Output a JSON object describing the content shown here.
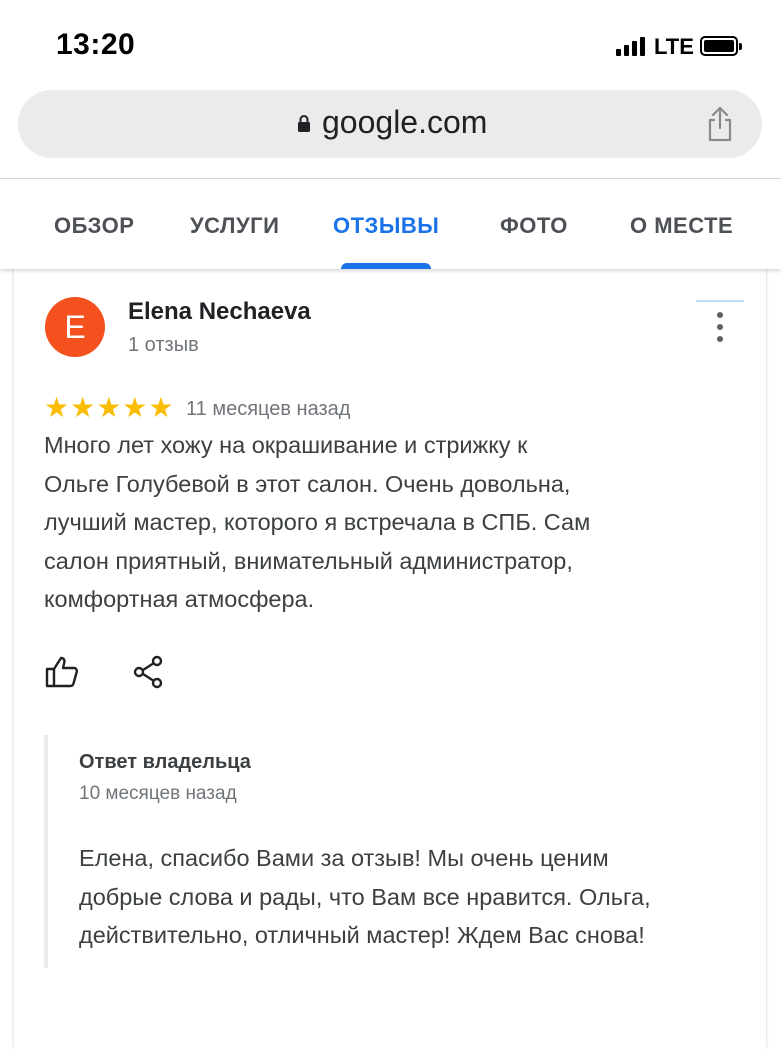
{
  "status_bar": {
    "time": "13:20",
    "network": "LTE",
    "icons": [
      "signal-bars-icon",
      "battery-icon"
    ]
  },
  "browser": {
    "url": "google.com",
    "icons": [
      "lock-icon",
      "share-icon"
    ]
  },
  "tabs": [
    {
      "label": "ОБЗОР",
      "active": false
    },
    {
      "label": "УСЛУГИ",
      "active": false
    },
    {
      "label": "ОТЗЫВЫ",
      "active": true
    },
    {
      "label": "ФОТО",
      "active": false
    },
    {
      "label": "О МЕСТЕ",
      "active": false
    }
  ],
  "review": {
    "avatar_letter": "E",
    "avatar_color": "#f4511e",
    "author": "Elena Nechaeva",
    "author_meta": "1 отзыв",
    "rating": 5,
    "rating_max": 5,
    "stars_text": "★★★★★",
    "star_color": "#fbbc04",
    "time_ago": "11 месяцев назад",
    "text_lines": [
      "Много лет хожу на окрашивание и стрижку к",
      "Ольге Голубевой в этот салон. Очень довольна,",
      "лучший мастер, которого я встречала в СПБ. Сам",
      "салон приятный, внимательный администратор,",
      "комфортная атмосфера."
    ],
    "actions": [
      "thumb-up-icon",
      "share-icon"
    ],
    "owner_reply": {
      "title": "Ответ владельца",
      "date": "10 месяцев назад",
      "text_lines": [
        "Елена, спасибо Вами за отзыв! Мы очень ценим",
        "добрые слова и рады, что Вам все нравится. Ольга,",
        "действительно, отличный мастер! Ждем Вас снова!"
      ]
    }
  },
  "colors": {
    "accent": "#1a73e8",
    "secondary_text": "#70757a"
  }
}
